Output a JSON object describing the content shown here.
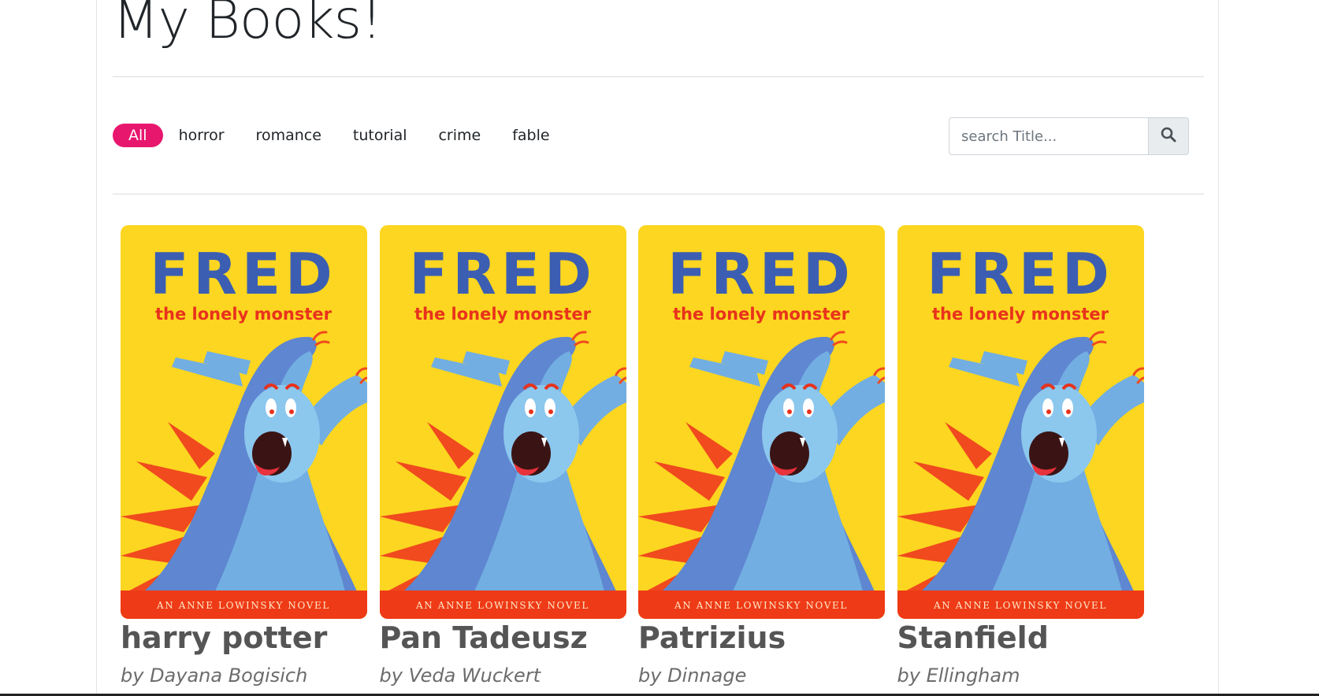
{
  "page": {
    "title": "My Books!"
  },
  "filters": {
    "items": [
      "All",
      "horror",
      "romance",
      "tutorial",
      "crime",
      "fable"
    ],
    "active": "All",
    "active_color": "#e8176e"
  },
  "search": {
    "placeholder": "search Title...",
    "icon": "search-icon"
  },
  "cover": {
    "headline": "FRED",
    "subtitle": "the lonely monster",
    "footer": "AN ANNE LOWINSKY NOVEL",
    "colors": {
      "background": "#fcd620",
      "headline": "#3c5eb2",
      "subtitle": "#e8321c",
      "footer_band": "#ee3a16",
      "monster_dark": "#5f86d0",
      "monster_light": "#72aee2",
      "spikes": "#f04a1e"
    }
  },
  "books": [
    {
      "title": "harry potter",
      "author": "by Dayana Bogisich"
    },
    {
      "title": "Pan Tadeusz",
      "author": "by Veda Wuckert"
    },
    {
      "title": "Patrizius",
      "author": "by Dinnage"
    },
    {
      "title": "Stanfield",
      "author": "by Ellingham"
    }
  ]
}
